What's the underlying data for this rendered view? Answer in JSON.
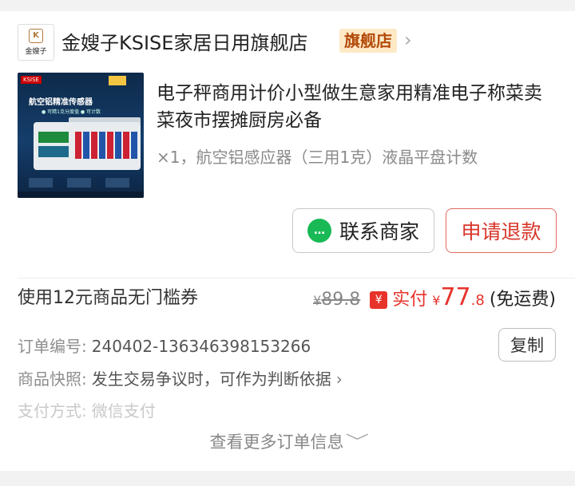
{
  "shop": {
    "logo_text": "金嫂子",
    "logo_mark": "K",
    "name": "金嫂子KSISE家居日用旗舰店",
    "badge": "旗舰店",
    "chevron": "›"
  },
  "product": {
    "image_brand": "KSISE",
    "image_headline": "航空铝精准传感器",
    "image_subtext": "● 可精1克分度值 ● 可计数",
    "title": "电子秤商用计价小型做生意家用精准电子称菜卖菜夜市摆摊厨房必备",
    "spec": "×1，航空铝感应器（三用1克）液晶平盘计数"
  },
  "actions": {
    "contact_icon": "…",
    "contact_label": "联系商家",
    "refund_label": "申请退款"
  },
  "pricing": {
    "coupon": "使用12元商品无门槛券",
    "original_symbol": "¥",
    "original": "89.8",
    "pay_icon": "¥",
    "paid_label": "实付",
    "paid_symbol": "¥",
    "paid_integer": "77",
    "paid_decimal": ".8",
    "freight": "(免运费)"
  },
  "order_info": {
    "order_no_label": "订单编号:",
    "order_no": "240402-136346398153266",
    "copy_label": "复制",
    "snapshot_label": "商品快照:",
    "snapshot_value": "发生交易争议时，可作为判断依据",
    "snapshot_chevron": "›",
    "payment_label": "支付方式:",
    "payment_value": "微信支付",
    "more_label": "查看更多订单信息",
    "more_icon": "﹀"
  },
  "colors": {
    "accent_red": "#e8332b",
    "refund_red": "#d8362a",
    "badge_bg": "#fde9c6",
    "wechat_green": "#19b955"
  }
}
